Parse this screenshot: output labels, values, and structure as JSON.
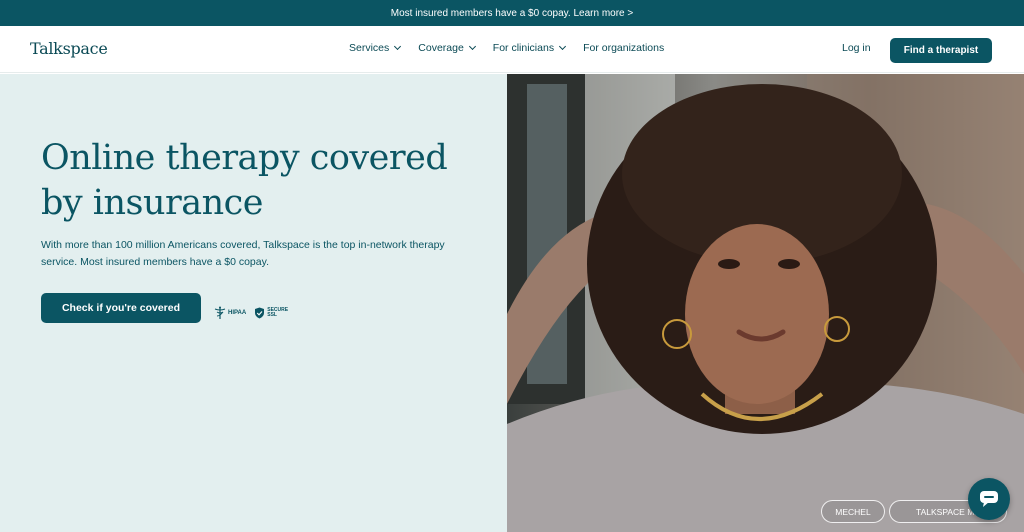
{
  "banner": {
    "text": "Most insured members have a $0 copay. Learn more >"
  },
  "nav": {
    "logo": "Talkspace",
    "items": [
      {
        "label": "Services",
        "dropdown": true
      },
      {
        "label": "Coverage",
        "dropdown": true
      },
      {
        "label": "For clinicians",
        "dropdown": true
      },
      {
        "label": "For organizations",
        "dropdown": false
      }
    ],
    "login": "Log in",
    "cta": "Find a therapist"
  },
  "hero": {
    "headline_line1": "Online therapy covered",
    "headline_line2": "by insurance",
    "subtext": "With more than 100 million Americans covered, Talkspace is the top in-network therapy service. Most insured members have a $0 copay.",
    "cta": "Check if you're covered",
    "badges": [
      {
        "icon": "caduceus-icon",
        "label": "HIPAA"
      },
      {
        "icon": "shield-check-icon",
        "label_line1": "SECURE",
        "label_line2": "SSL"
      }
    ]
  },
  "photo": {
    "chips": [
      "MECHEL",
      "TALKSPACE ME"
    ]
  },
  "chat": {
    "icon": "chat-bubble-icon"
  },
  "colors": {
    "brand": "#0b5563",
    "hero_bg": "#e3efef"
  }
}
